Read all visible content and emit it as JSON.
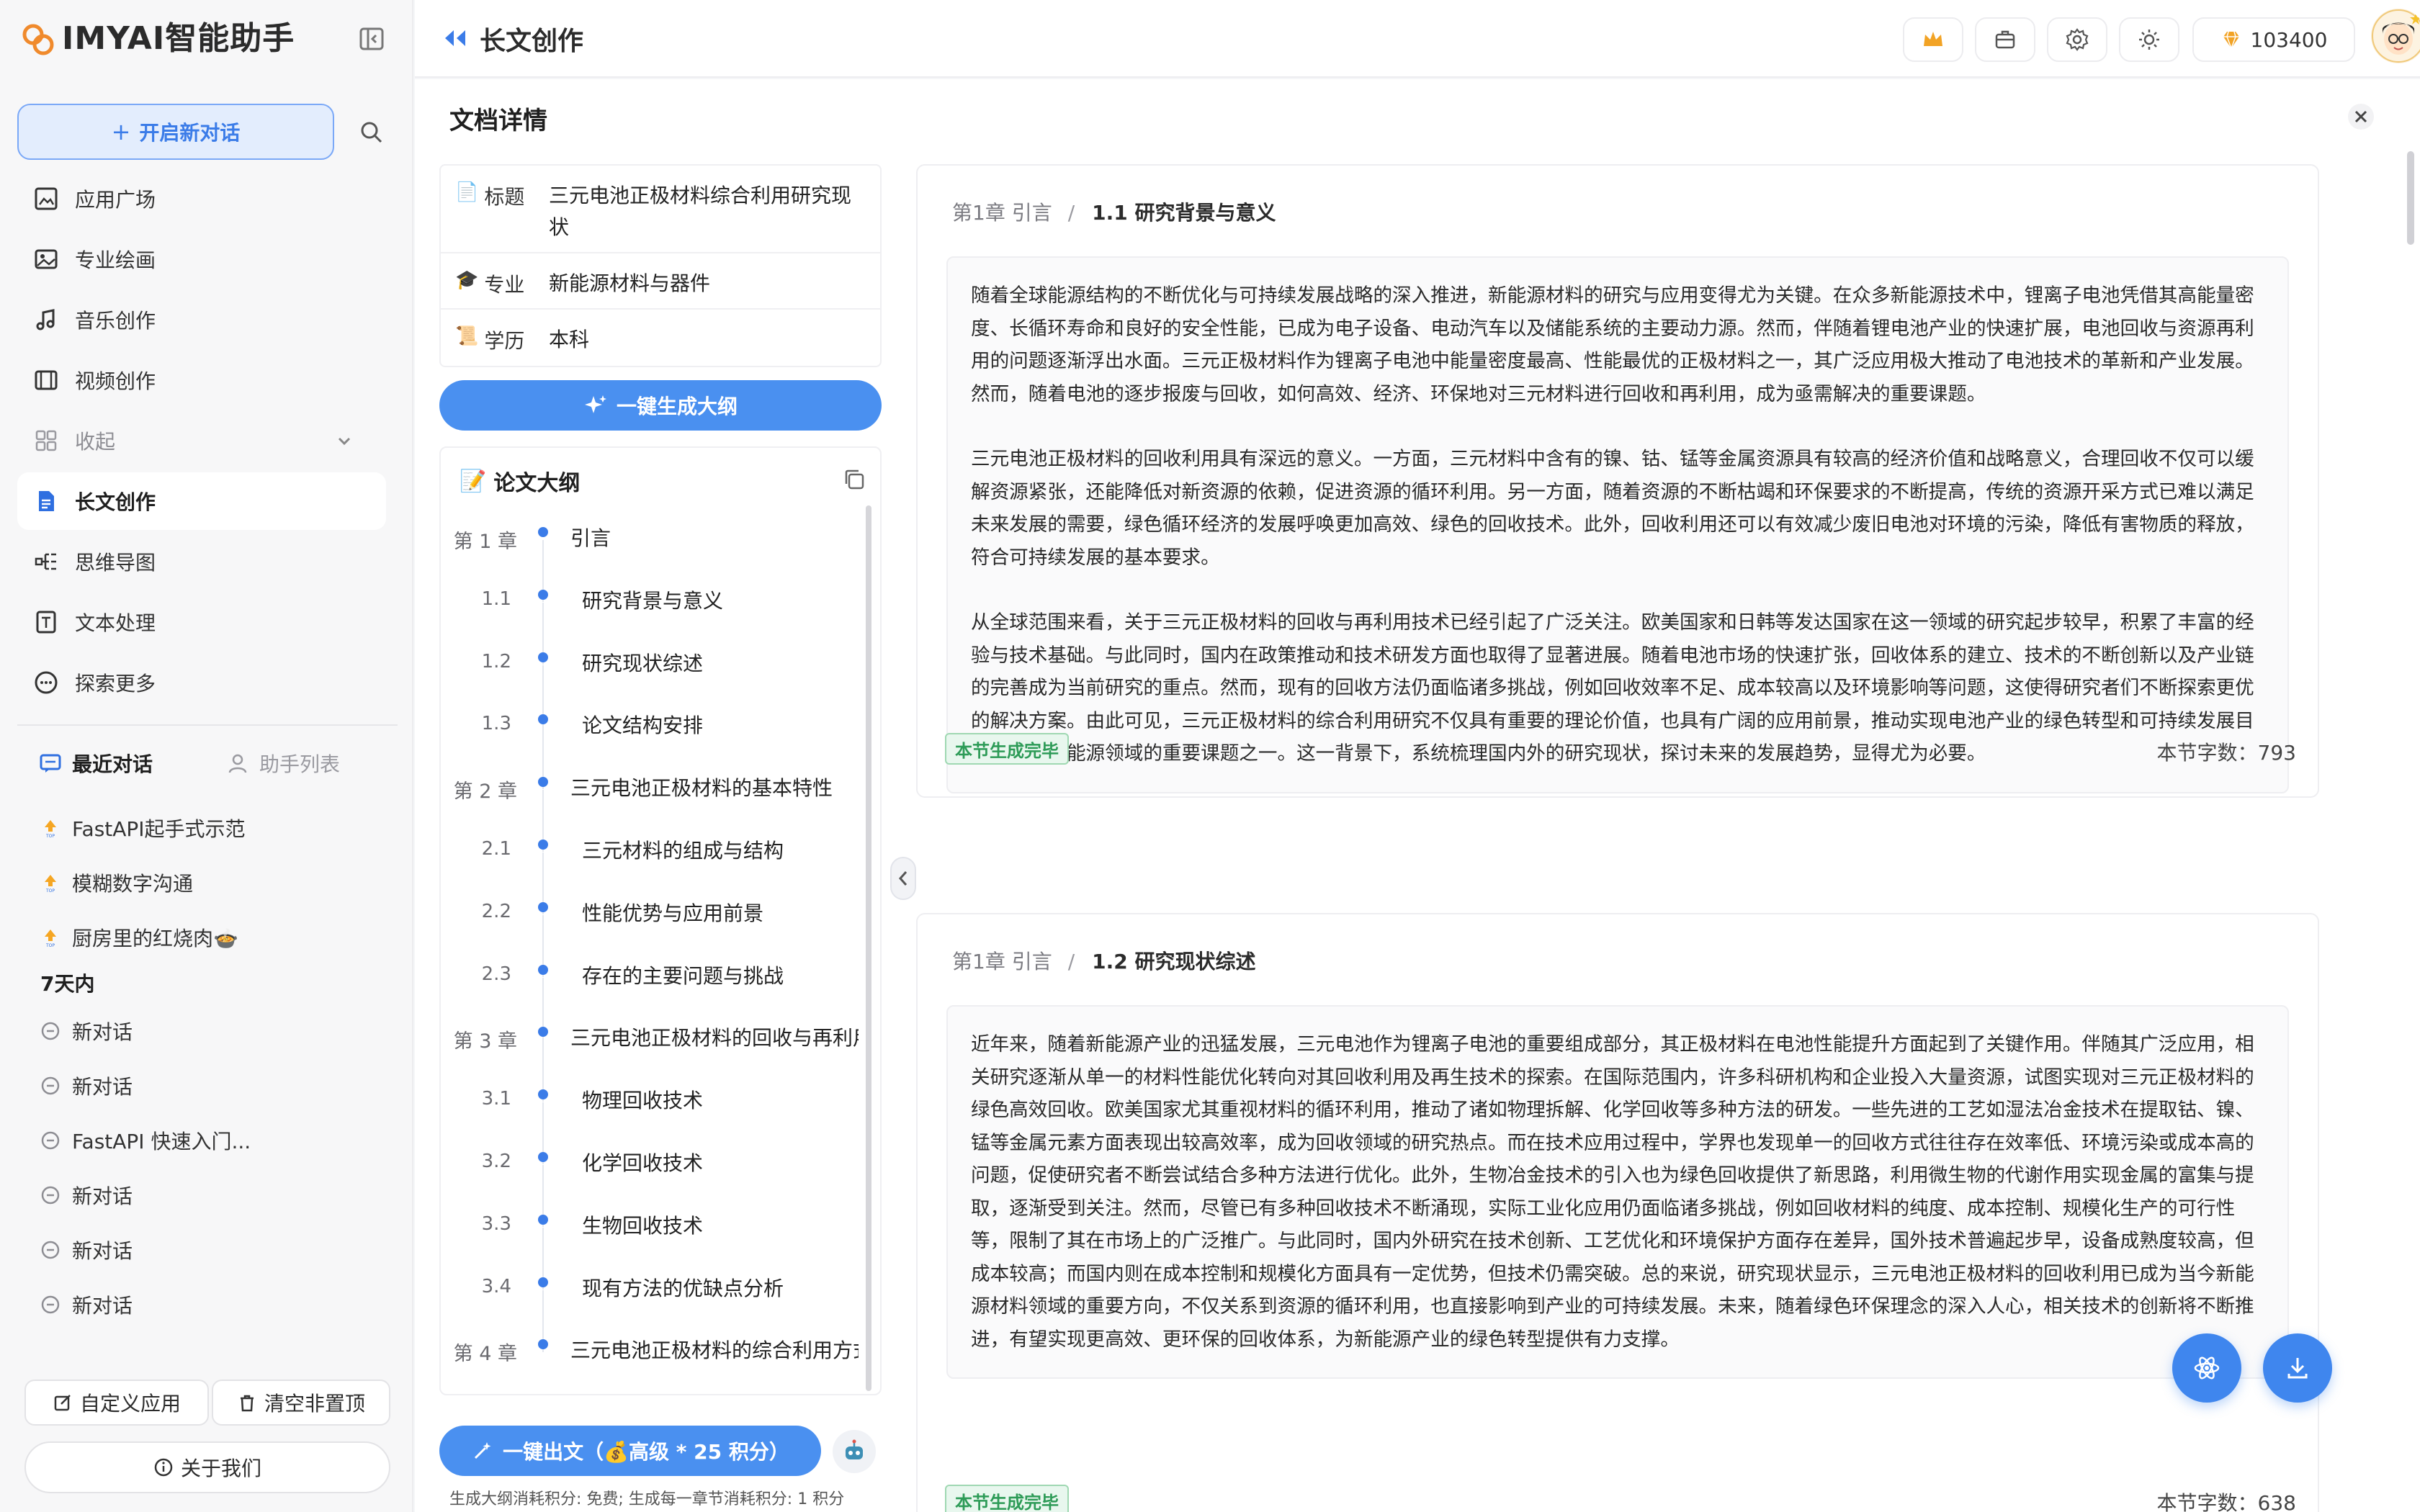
{
  "app": {
    "logo_text": "IMYAI智能助手"
  },
  "sidebar": {
    "new_chat_label": "开启新对话",
    "nav": [
      {
        "label": "应用广场",
        "icon": "grid-image-icon"
      },
      {
        "label": "专业绘画",
        "icon": "picture-icon"
      },
      {
        "label": "音乐创作",
        "icon": "music-note-icon"
      },
      {
        "label": "视频创作",
        "icon": "film-icon"
      },
      {
        "label": "收起",
        "icon": "apps-icon"
      },
      {
        "label": "长文创作",
        "icon": "document-icon"
      },
      {
        "label": "思维导图",
        "icon": "mindmap-icon"
      },
      {
        "label": "文本处理",
        "icon": "text-doc-icon"
      },
      {
        "label": "探索更多",
        "icon": "more-circle-icon"
      }
    ],
    "tabs": {
      "recent": "最近对话",
      "assistants": "助手列表"
    },
    "history": {
      "pinned": [
        "FastAPI起手式示范",
        "模糊数字沟通",
        "厨房里的红烧肉🍲"
      ],
      "group_label": "7天内",
      "recent": [
        "新对话",
        "新对话",
        "FastAPI 快速入门...",
        "新对话",
        "新对话",
        "新对话"
      ]
    },
    "custom_app_label": "自定义应用",
    "clear_label": "清空非置顶",
    "about_label": "关于我们"
  },
  "header": {
    "title": "长文创作",
    "points": "103400"
  },
  "document": {
    "title": "文档详情",
    "info": [
      {
        "key": "标题",
        "emoji": "📄",
        "value": "三元电池正极材料综合利用研究现状"
      },
      {
        "key": "专业",
        "emoji": "🎓",
        "value": "新能源材料与器件"
      },
      {
        "key": "学历",
        "emoji": "📜",
        "value": "本科"
      }
    ],
    "generate_outline_label": "一键生成大纲",
    "outline_title": "论文大纲",
    "outline_emoji": "📝",
    "outline": [
      {
        "num": "第 1 章",
        "text": "引言",
        "level": 1
      },
      {
        "num": "1.1",
        "text": "研究背景与意义",
        "level": 2
      },
      {
        "num": "1.2",
        "text": "研究现状综述",
        "level": 2
      },
      {
        "num": "1.3",
        "text": "论文结构安排",
        "level": 2
      },
      {
        "num": "第 2 章",
        "text": "三元电池正极材料的基本特性",
        "level": 1
      },
      {
        "num": "2.1",
        "text": "三元材料的组成与结构",
        "level": 2
      },
      {
        "num": "2.2",
        "text": "性能优势与应用前景",
        "level": 2
      },
      {
        "num": "2.3",
        "text": "存在的主要问题与挑战",
        "level": 2
      },
      {
        "num": "第 3 章",
        "text": "三元电池正极材料的回收与再利用",
        "level": 1
      },
      {
        "num": "3.1",
        "text": "物理回收技术",
        "level": 2
      },
      {
        "num": "3.2",
        "text": "化学回收技术",
        "level": 2
      },
      {
        "num": "3.3",
        "text": "生物回收技术",
        "level": 2
      },
      {
        "num": "3.4",
        "text": "现有方法的优缺点分析",
        "level": 2
      },
      {
        "num": "第 4 章",
        "text": "三元电池正极材料的综合利用方式",
        "level": 1
      }
    ],
    "export_label": "一键出文（💰高级 * 25 积分）",
    "cost_note": "生成大纲消耗积分: 免费; 生成每一章节消耗积分: 1 积分",
    "sections": [
      {
        "chapter": "第1章 引言",
        "section": "1.1 研究背景与意义",
        "paragraphs": [
          "随着全球能源结构的不断优化与可持续发展战略的深入推进，新能源材料的研究与应用变得尤为关键。在众多新能源技术中，锂离子电池凭借其高能量密度、长循环寿命和良好的安全性能，已成为电子设备、电动汽车以及储能系统的主要动力源。然而，伴随着锂电池产业的快速扩展，电池回收与资源再利用的问题逐渐浮出水面。三元正极材料作为锂离子电池中能量密度最高、性能最优的正极材料之一，其广泛应用极大推动了电池技术的革新和产业发展。然而，随着电池的逐步报废与回收，如何高效、经济、环保地对三元材料进行回收和再利用，成为亟需解决的重要课题。",
          "三元电池正极材料的回收利用具有深远的意义。一方面，三元材料中含有的镍、钴、锰等金属资源具有较高的经济价值和战略意义，合理回收不仅可以缓解资源紧张，还能降低对新资源的依赖，促进资源的循环利用。另一方面，随着资源的不断枯竭和环保要求的不断提高，传统的资源开采方式已难以满足未来发展的需要，绿色循环经济的发展呼唤更加高效、绿色的回收技术。此外，回收利用还可以有效减少废旧电池对环境的污染，降低有害物质的释放，符合可持续发展的基本要求。",
          "从全球范围来看，关于三元正极材料的回收与再利用技术已经引起了广泛关注。欧美国家和日韩等发达国家在这一领域的研究起步较早，积累了丰富的经验与技术基础。与此同时，国内在政策推动和技术研发方面也取得了显著进展。随着电池市场的快速扩张，回收体系的建立、技术的不断创新以及产业链的完善成为当前研究的重点。然而，现有的回收方法仍面临诸多挑战，例如回收效率不足、成本较高以及环境影响等问题，这使得研究者们不断探索更优的解决方案。由此可见，三元正极材料的综合利用研究不仅具有重要的理论价值，也具有广阔的应用前景，推动实现电池产业的绿色转型和可持续发展目标，成为新能源领域的重要课题之一。这一背景下，系统梳理国内外的研究现状，探讨未来的发展趋势，显得尤为必要。"
        ],
        "status": "本节生成完毕",
        "word_count": "本节字数：793"
      },
      {
        "chapter": "第1章 引言",
        "section": "1.2 研究现状综述",
        "paragraphs": [
          "近年来，随着新能源产业的迅猛发展，三元电池作为锂离子电池的重要组成部分，其正极材料在电池性能提升方面起到了关键作用。伴随其广泛应用，相关研究逐渐从单一的材料性能优化转向对其回收利用及再生技术的探索。在国际范围内，许多科研机构和企业投入大量资源，试图实现对三元正极材料的绿色高效回收。欧美国家尤其重视材料的循环利用，推动了诸如物理拆解、化学回收等多种方法的研发。一些先进的工艺如湿法冶金技术在提取钴、镍、锰等金属元素方面表现出较高效率，成为回收领域的研究热点。而在技术应用过程中，学界也发现单一的回收方式往往存在效率低、环境污染或成本高的问题，促使研究者不断尝试结合多种方法进行优化。此外，生物冶金技术的引入也为绿色回收提供了新思路，利用微生物的代谢作用实现金属的富集与提取，逐渐受到关注。然而，尽管已有多种回收技术不断涌现，实际工业化应用仍面临诸多挑战，例如回收材料的纯度、成本控制、规模化生产的可行性等，限制了其在市场上的广泛推广。与此同时，国内外研究在技术创新、工艺优化和环境保护方面存在差异，国外技术普遍起步早，设备成熟度较高，但成本较高；而国内则在成本控制和规模化方面具有一定优势，但技术仍需突破。总的来说，研究现状显示，三元电池正极材料的回收利用已成为当今新能源材料领域的重要方向，不仅关系到资源的循环利用，也直接影响到产业的可持续发展。未来，随着绿色环保理念的深入人心，相关技术的创新将不断推进，有望实现更高效、更环保的回收体系，为新能源产业的绿色转型提供有力支撑。"
        ],
        "status": "本节生成完毕",
        "word_count": "本节字数：638"
      }
    ]
  }
}
